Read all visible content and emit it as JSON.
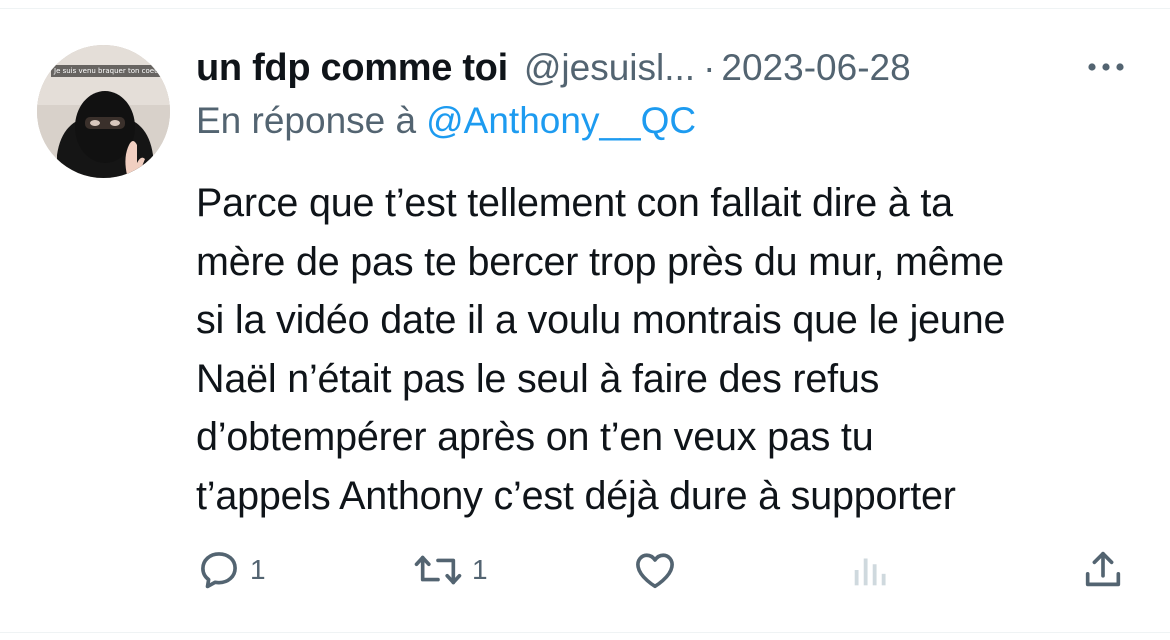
{
  "tweet": {
    "display_name": "un fdp comme toi",
    "handle": "@jesuisl...",
    "separator": "·",
    "date": "2023-06-28",
    "reply_prefix": "En réponse à",
    "reply_to": "@Anthony__QC",
    "text_lines": [
      "Parce que t’est tellement con fallait dire à ta",
      "mère de pas te bercer trop près du mur, même",
      "si la vidéo date il a voulu montrais que le jeune",
      "Naël n’était pas le seul à faire des refus",
      "d’obtempérer après on t’en veux pas tu",
      "t’appels Anthony c’est déjà dure à supporter"
    ],
    "avatar_caption": "Je suis venu braquer ton coeur"
  },
  "actions": {
    "reply_count": "1",
    "retweet_count": "1"
  },
  "icons": {
    "more": "more-icon",
    "reply": "reply-icon",
    "retweet": "retweet-icon",
    "like": "heart-icon",
    "views": "analytics-icon",
    "share": "share-icon"
  },
  "colors": {
    "text_primary": "#0f1419",
    "text_secondary": "#536471",
    "accent": "#1d9bf0",
    "divider": "#eff3f4",
    "disabled_icon": "#cfd9de"
  }
}
